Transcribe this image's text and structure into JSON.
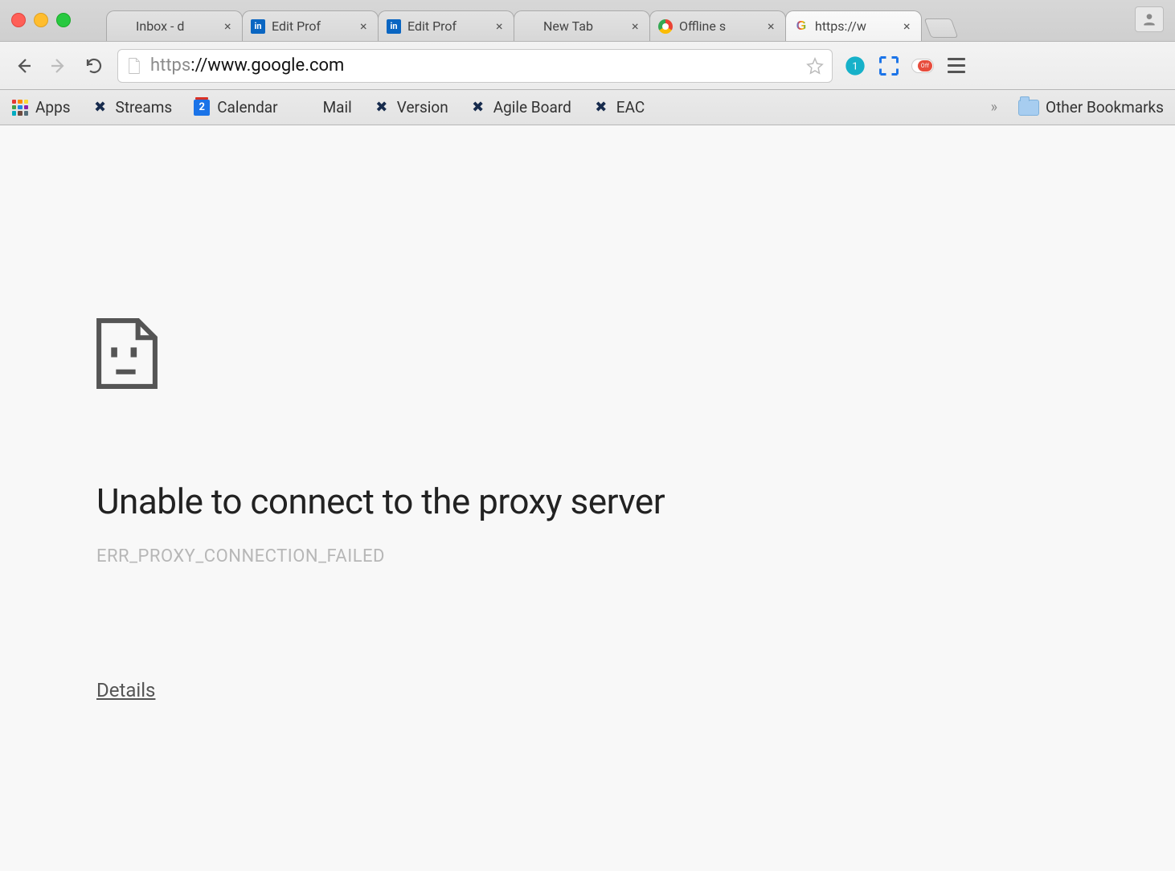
{
  "tabs": [
    {
      "title": "Inbox - d",
      "favicon": "gmail",
      "active": false
    },
    {
      "title": "Edit Prof",
      "favicon": "linkedin",
      "active": false
    },
    {
      "title": "Edit Prof",
      "favicon": "linkedin",
      "active": false
    },
    {
      "title": "New Tab",
      "favicon": "none",
      "active": false
    },
    {
      "title": "Offline s",
      "favicon": "chrome",
      "active": false
    },
    {
      "title": "https://w",
      "favicon": "google",
      "active": true
    }
  ],
  "toolbar": {
    "url_scheme": "https",
    "url_rest": "://www.google.com",
    "switch_label": "Off"
  },
  "bookmarks": {
    "items": [
      {
        "label": "Apps",
        "icon": "apps"
      },
      {
        "label": "Streams",
        "icon": "jira"
      },
      {
        "label": "Calendar",
        "icon": "cal",
        "badge": "2"
      },
      {
        "label": "Mail",
        "icon": "gmail"
      },
      {
        "label": "Version",
        "icon": "jira"
      },
      {
        "label": "Agile Board",
        "icon": "jira"
      },
      {
        "label": "EAC",
        "icon": "jira"
      }
    ],
    "other_label": "Other Bookmarks"
  },
  "error": {
    "title": "Unable to connect to the proxy server",
    "code": "ERR_PROXY_CONNECTION_FAILED",
    "details": "Details"
  }
}
